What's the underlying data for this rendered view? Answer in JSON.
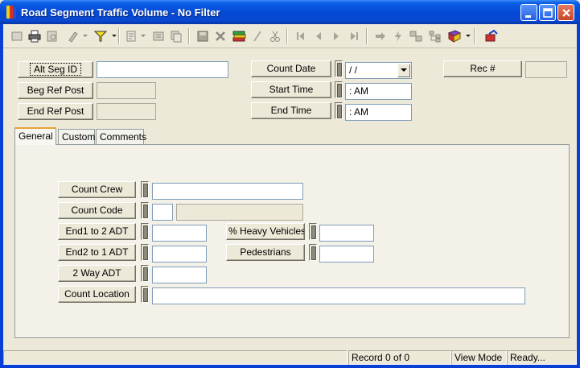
{
  "window": {
    "title": "Road Segment Traffic Volume - No Filter"
  },
  "colors": {
    "titlebar": "#0548D4",
    "face": "#ECE9D8",
    "tab_accent": "#E8A23A"
  },
  "toolbar": {
    "icons": [
      "select-all-icon",
      "print-icon",
      "print-preview-icon",
      "edit-icon",
      "filter-icon",
      "report-icon",
      "properties-icon",
      "copy-record-icon",
      "save-icon",
      "delete-icon",
      "books-icon",
      "edit-line-icon",
      "cut-icon",
      "first-record-icon",
      "previous-record-icon",
      "next-record-icon",
      "last-record-icon",
      "jump-icon",
      "lightning-icon",
      "grid-icon",
      "tree-icon",
      "library-icon",
      "exit-icon"
    ]
  },
  "header": {
    "alt_seg_id_label": "Alt Seg ID",
    "alt_seg_id_value": "",
    "beg_ref_post_label": "Beg Ref Post",
    "beg_ref_post_value": "",
    "end_ref_post_label": "End Ref Post",
    "end_ref_post_value": "",
    "count_date_label": "Count Date",
    "count_date_value": " / /",
    "start_time_label": "Start Time",
    "start_time_value": " :  AM",
    "end_time_label": "End Time",
    "end_time_value": " :  AM",
    "rec_label": "Rec #",
    "rec_value": ""
  },
  "tabs": [
    {
      "label": "General",
      "active": true
    },
    {
      "label": "Custom",
      "active": false
    },
    {
      "label": "Comments",
      "active": false
    }
  ],
  "general": {
    "count_crew_label": "Count Crew",
    "count_crew_value": "",
    "count_code_label": "Count Code",
    "count_code_value": "",
    "count_code_desc": "",
    "end1_to_2_adt_label": "End1 to 2 ADT",
    "end1_to_2_adt_value": "",
    "end2_to_1_adt_label": "End2 to 1 ADT",
    "end2_to_1_adt_value": "",
    "two_way_adt_label": "2 Way ADT",
    "two_way_adt_value": "",
    "count_location_label": "Count Location",
    "count_location_value": "",
    "heavy_vehicles_label": "% Heavy Vehicles",
    "heavy_vehicles_value": "",
    "pedestrians_label": "Pedestrians",
    "pedestrians_value": ""
  },
  "status": {
    "record": "Record 0 of 0",
    "mode": "View Mode",
    "state": "Ready..."
  }
}
